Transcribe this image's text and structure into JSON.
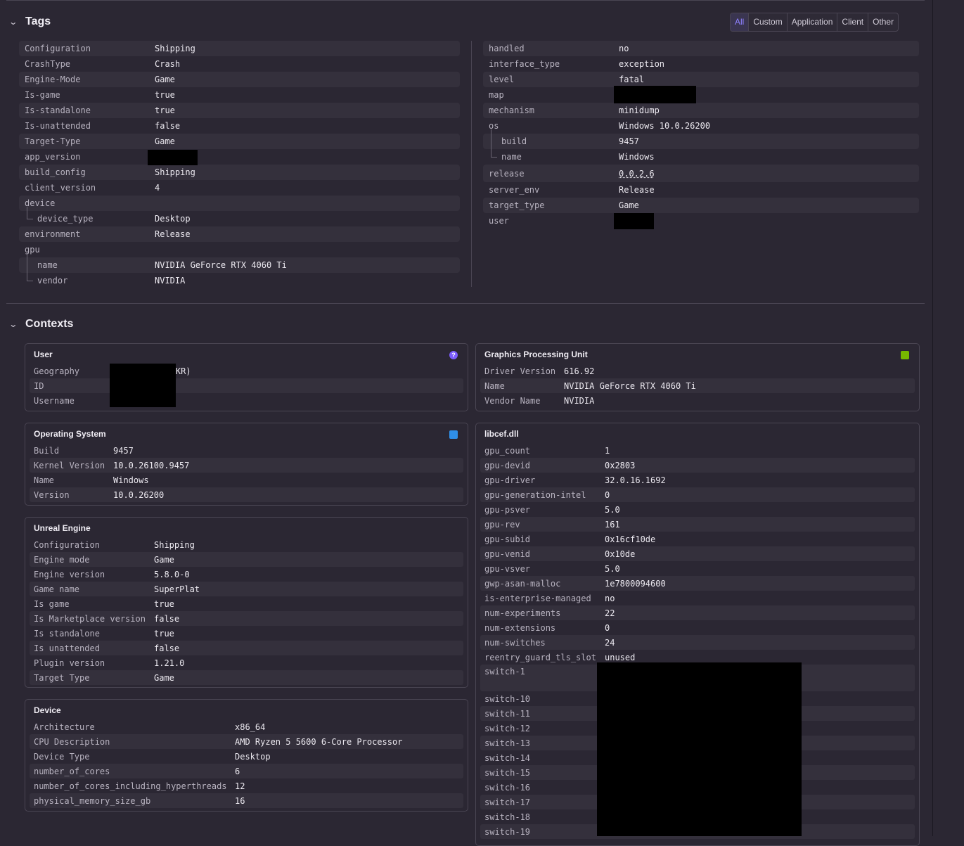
{
  "tags": {
    "title": "Tags",
    "filters": [
      "All",
      "Custom",
      "Application",
      "Client",
      "Other"
    ],
    "active_filter": "All",
    "left": [
      {
        "key": "Configuration",
        "value": "Shipping"
      },
      {
        "key": "CrashType",
        "value": "Crash"
      },
      {
        "key": "Engine-Mode",
        "value": "Game"
      },
      {
        "key": "Is-game",
        "value": "true"
      },
      {
        "key": "Is-standalone",
        "value": "true"
      },
      {
        "key": "Is-unattended",
        "value": "false"
      },
      {
        "key": "Target-Type",
        "value": "Game"
      },
      {
        "key": "app_version",
        "value": ""
      },
      {
        "key": "build_config",
        "value": "Shipping"
      },
      {
        "key": "client_version",
        "value": "4"
      },
      {
        "key": "device",
        "value": ""
      },
      {
        "key": "device_type",
        "value": "Desktop"
      },
      {
        "key": "environment",
        "value": "Release"
      },
      {
        "key": "gpu",
        "value": ""
      },
      {
        "key": "name",
        "value": "NVIDIA GeForce RTX 4060 Ti"
      },
      {
        "key": "vendor",
        "value": "NVIDIA"
      }
    ],
    "right": [
      {
        "key": "handled",
        "value": "no"
      },
      {
        "key": "interface_type",
        "value": "exception"
      },
      {
        "key": "level",
        "value": "fatal"
      },
      {
        "key": "map",
        "value": ""
      },
      {
        "key": "mechanism",
        "value": "minidump"
      },
      {
        "key": "os",
        "value": "Windows 10.0.26200"
      },
      {
        "key": "build",
        "value": "9457"
      },
      {
        "key": "name",
        "value": "Windows"
      },
      {
        "key": "release",
        "value": "0.0.2.6"
      },
      {
        "key": "server_env",
        "value": "Release"
      },
      {
        "key": "target_type",
        "value": "Game"
      },
      {
        "key": "user",
        "value": ""
      }
    ]
  },
  "contexts": {
    "title": "Contexts",
    "user": {
      "title": "User",
      "rows": [
        {
          "key": "Geography",
          "value": "South Korea (KR)"
        },
        {
          "key": "ID",
          "value": ""
        },
        {
          "key": "Username",
          "value": ""
        }
      ]
    },
    "gpu": {
      "title": "Graphics Processing Unit",
      "rows": [
        {
          "key": "Driver Version",
          "value": "616.92"
        },
        {
          "key": "Name",
          "value": "NVIDIA GeForce RTX 4060 Ti"
        },
        {
          "key": "Vendor Name",
          "value": "NVIDIA"
        }
      ]
    },
    "os": {
      "title": "Operating System",
      "rows": [
        {
          "key": "Build",
          "value": "9457"
        },
        {
          "key": "Kernel Version",
          "value": "10.0.26100.9457"
        },
        {
          "key": "Name",
          "value": "Windows"
        },
        {
          "key": "Version",
          "value": "10.0.26200"
        }
      ]
    },
    "unreal": {
      "title": "Unreal Engine",
      "rows": [
        {
          "key": "Configuration",
          "value": "Shipping"
        },
        {
          "key": "Engine mode",
          "value": "Game"
        },
        {
          "key": "Engine version",
          "value": "5.8.0-0"
        },
        {
          "key": "Game name",
          "value": "SuperPlat"
        },
        {
          "key": "Is game",
          "value": "true"
        },
        {
          "key": "Is Marketplace version",
          "value": "false"
        },
        {
          "key": "Is standalone",
          "value": "true"
        },
        {
          "key": "Is unattended",
          "value": "false"
        },
        {
          "key": "Plugin version",
          "value": "1.21.0"
        },
        {
          "key": "Target Type",
          "value": "Game"
        }
      ]
    },
    "device": {
      "title": "Device",
      "rows": [
        {
          "key": "Architecture",
          "value": "x86_64"
        },
        {
          "key": "CPU Description",
          "value": "AMD Ryzen 5 5600 6-Core Processor"
        },
        {
          "key": "Device Type",
          "value": "Desktop"
        },
        {
          "key": "number_of_cores",
          "value": "6"
        },
        {
          "key": "number_of_cores_including_hyperthreads",
          "value": "12"
        },
        {
          "key": "physical_memory_size_gb",
          "value": "16"
        }
      ]
    },
    "libcef": {
      "title": "libcef.dll",
      "rows": [
        {
          "key": "gpu_count",
          "value": "1"
        },
        {
          "key": "gpu-devid",
          "value": "0x2803"
        },
        {
          "key": "gpu-driver",
          "value": "32.0.16.1692"
        },
        {
          "key": "gpu-generation-intel",
          "value": "0"
        },
        {
          "key": "gpu-psver",
          "value": "5.0"
        },
        {
          "key": "gpu-rev",
          "value": "161"
        },
        {
          "key": "gpu-subid",
          "value": "0x16cf10de"
        },
        {
          "key": "gpu-venid",
          "value": "0x10de"
        },
        {
          "key": "gpu-vsver",
          "value": "5.0"
        },
        {
          "key": "gwp-asan-malloc",
          "value": "1e7800094600"
        },
        {
          "key": "is-enterprise-managed",
          "value": "no"
        },
        {
          "key": "num-experiments",
          "value": "22"
        },
        {
          "key": "num-extensions",
          "value": "0"
        },
        {
          "key": "num-switches",
          "value": "24"
        },
        {
          "key": "reentry_guard_tls_slot",
          "value": "unused"
        },
        {
          "key": "switch-1",
          "value": ""
        },
        {
          "key": "switch-10",
          "value": ""
        },
        {
          "key": "switch-11",
          "value": ""
        },
        {
          "key": "switch-12",
          "value": ""
        },
        {
          "key": "switch-13",
          "value": ""
        },
        {
          "key": "switch-14",
          "value": ""
        },
        {
          "key": "switch-15",
          "value": ""
        },
        {
          "key": "switch-16",
          "value": ""
        },
        {
          "key": "switch-17",
          "value": ""
        },
        {
          "key": "switch-18",
          "value": ""
        },
        {
          "key": "switch-19",
          "value": ""
        }
      ]
    }
  },
  "colors": {
    "background": "#2b2733",
    "accent": "#8f82ff",
    "row_shade": "#34303c"
  }
}
